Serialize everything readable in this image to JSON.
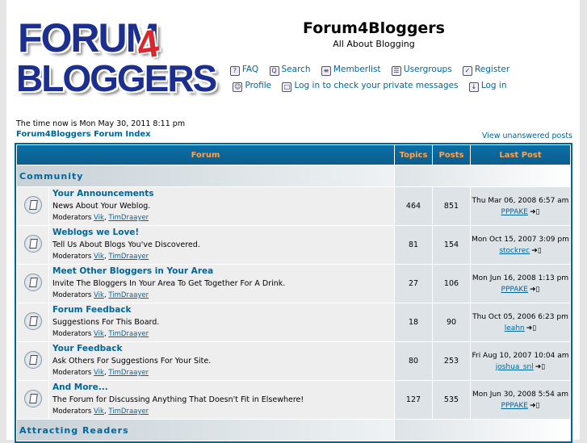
{
  "logo": {
    "line1": "FORUM",
    "line2": "BLOGGERS",
    "digit": "4"
  },
  "header": {
    "title": "Forum4Bloggers",
    "subtitle": "All About Blogging"
  },
  "nav": {
    "row1": [
      {
        "icon": "?",
        "label": "FAQ"
      },
      {
        "icon": "Q",
        "label": "Search"
      },
      {
        "icon": "≡",
        "label": "Memberlist"
      },
      {
        "icon": "☰",
        "label": "Usergroups"
      },
      {
        "icon": "✓",
        "label": "Register"
      }
    ],
    "row2": [
      {
        "icon": "☺",
        "label": "Profile"
      },
      {
        "icon": "□",
        "label": "Log in to check your private messages"
      },
      {
        "icon": "↓",
        "label": "Log in"
      }
    ]
  },
  "time_text": "The time now is Mon May 30, 2011 8:11 pm",
  "index_link": "Forum4Bloggers Forum Index",
  "unanswered_link": "View unanswered posts",
  "table": {
    "headers": [
      "Forum",
      "Topics",
      "Posts",
      "Last Post"
    ],
    "categories": [
      "Community",
      "Attracting Readers"
    ],
    "moderators_label": "Moderators",
    "mod1": "Vik",
    "mod2": "TimDraayer",
    "forums": [
      {
        "name": "Your Announcements",
        "desc": "News About Your Weblog.",
        "topics": "464",
        "posts": "851",
        "last_date": "Thu Mar 06, 2008 6:57 am",
        "last_user": "PPPAKE"
      },
      {
        "name": "Weblogs we Love!",
        "desc": "Tell Us About Blogs You've Discovered.",
        "topics": "81",
        "posts": "154",
        "last_date": "Mon Oct 15, 2007 3:09 pm",
        "last_user": "stockrec"
      },
      {
        "name": "Meet Other Bloggers in Your Area",
        "desc": "Invite The Bloggers In Your Area To Get Together For A Drink.",
        "topics": "27",
        "posts": "106",
        "last_date": "Mon Jun 16, 2008 1:13 pm",
        "last_user": "PPPAKE"
      },
      {
        "name": "Forum Feedback",
        "desc": "Suggestions For This Board.",
        "topics": "18",
        "posts": "90",
        "last_date": "Thu Oct 05, 2006 6:23 pm",
        "last_user": "leahn"
      },
      {
        "name": "Your Feedback",
        "desc": "Ask Others For Suggestions For Your Site.",
        "topics": "80",
        "posts": "253",
        "last_date": "Fri Aug 10, 2007 10:04 am",
        "last_user": "joshua_snl"
      },
      {
        "name": "And More...",
        "desc": "The Forum for Discussing Anything That Doesn't Fit in Elsewhere!",
        "topics": "127",
        "posts": "535",
        "last_date": "Mon Jun 30, 2008 5:54 am",
        "last_user": "PPPAKE"
      }
    ]
  }
}
